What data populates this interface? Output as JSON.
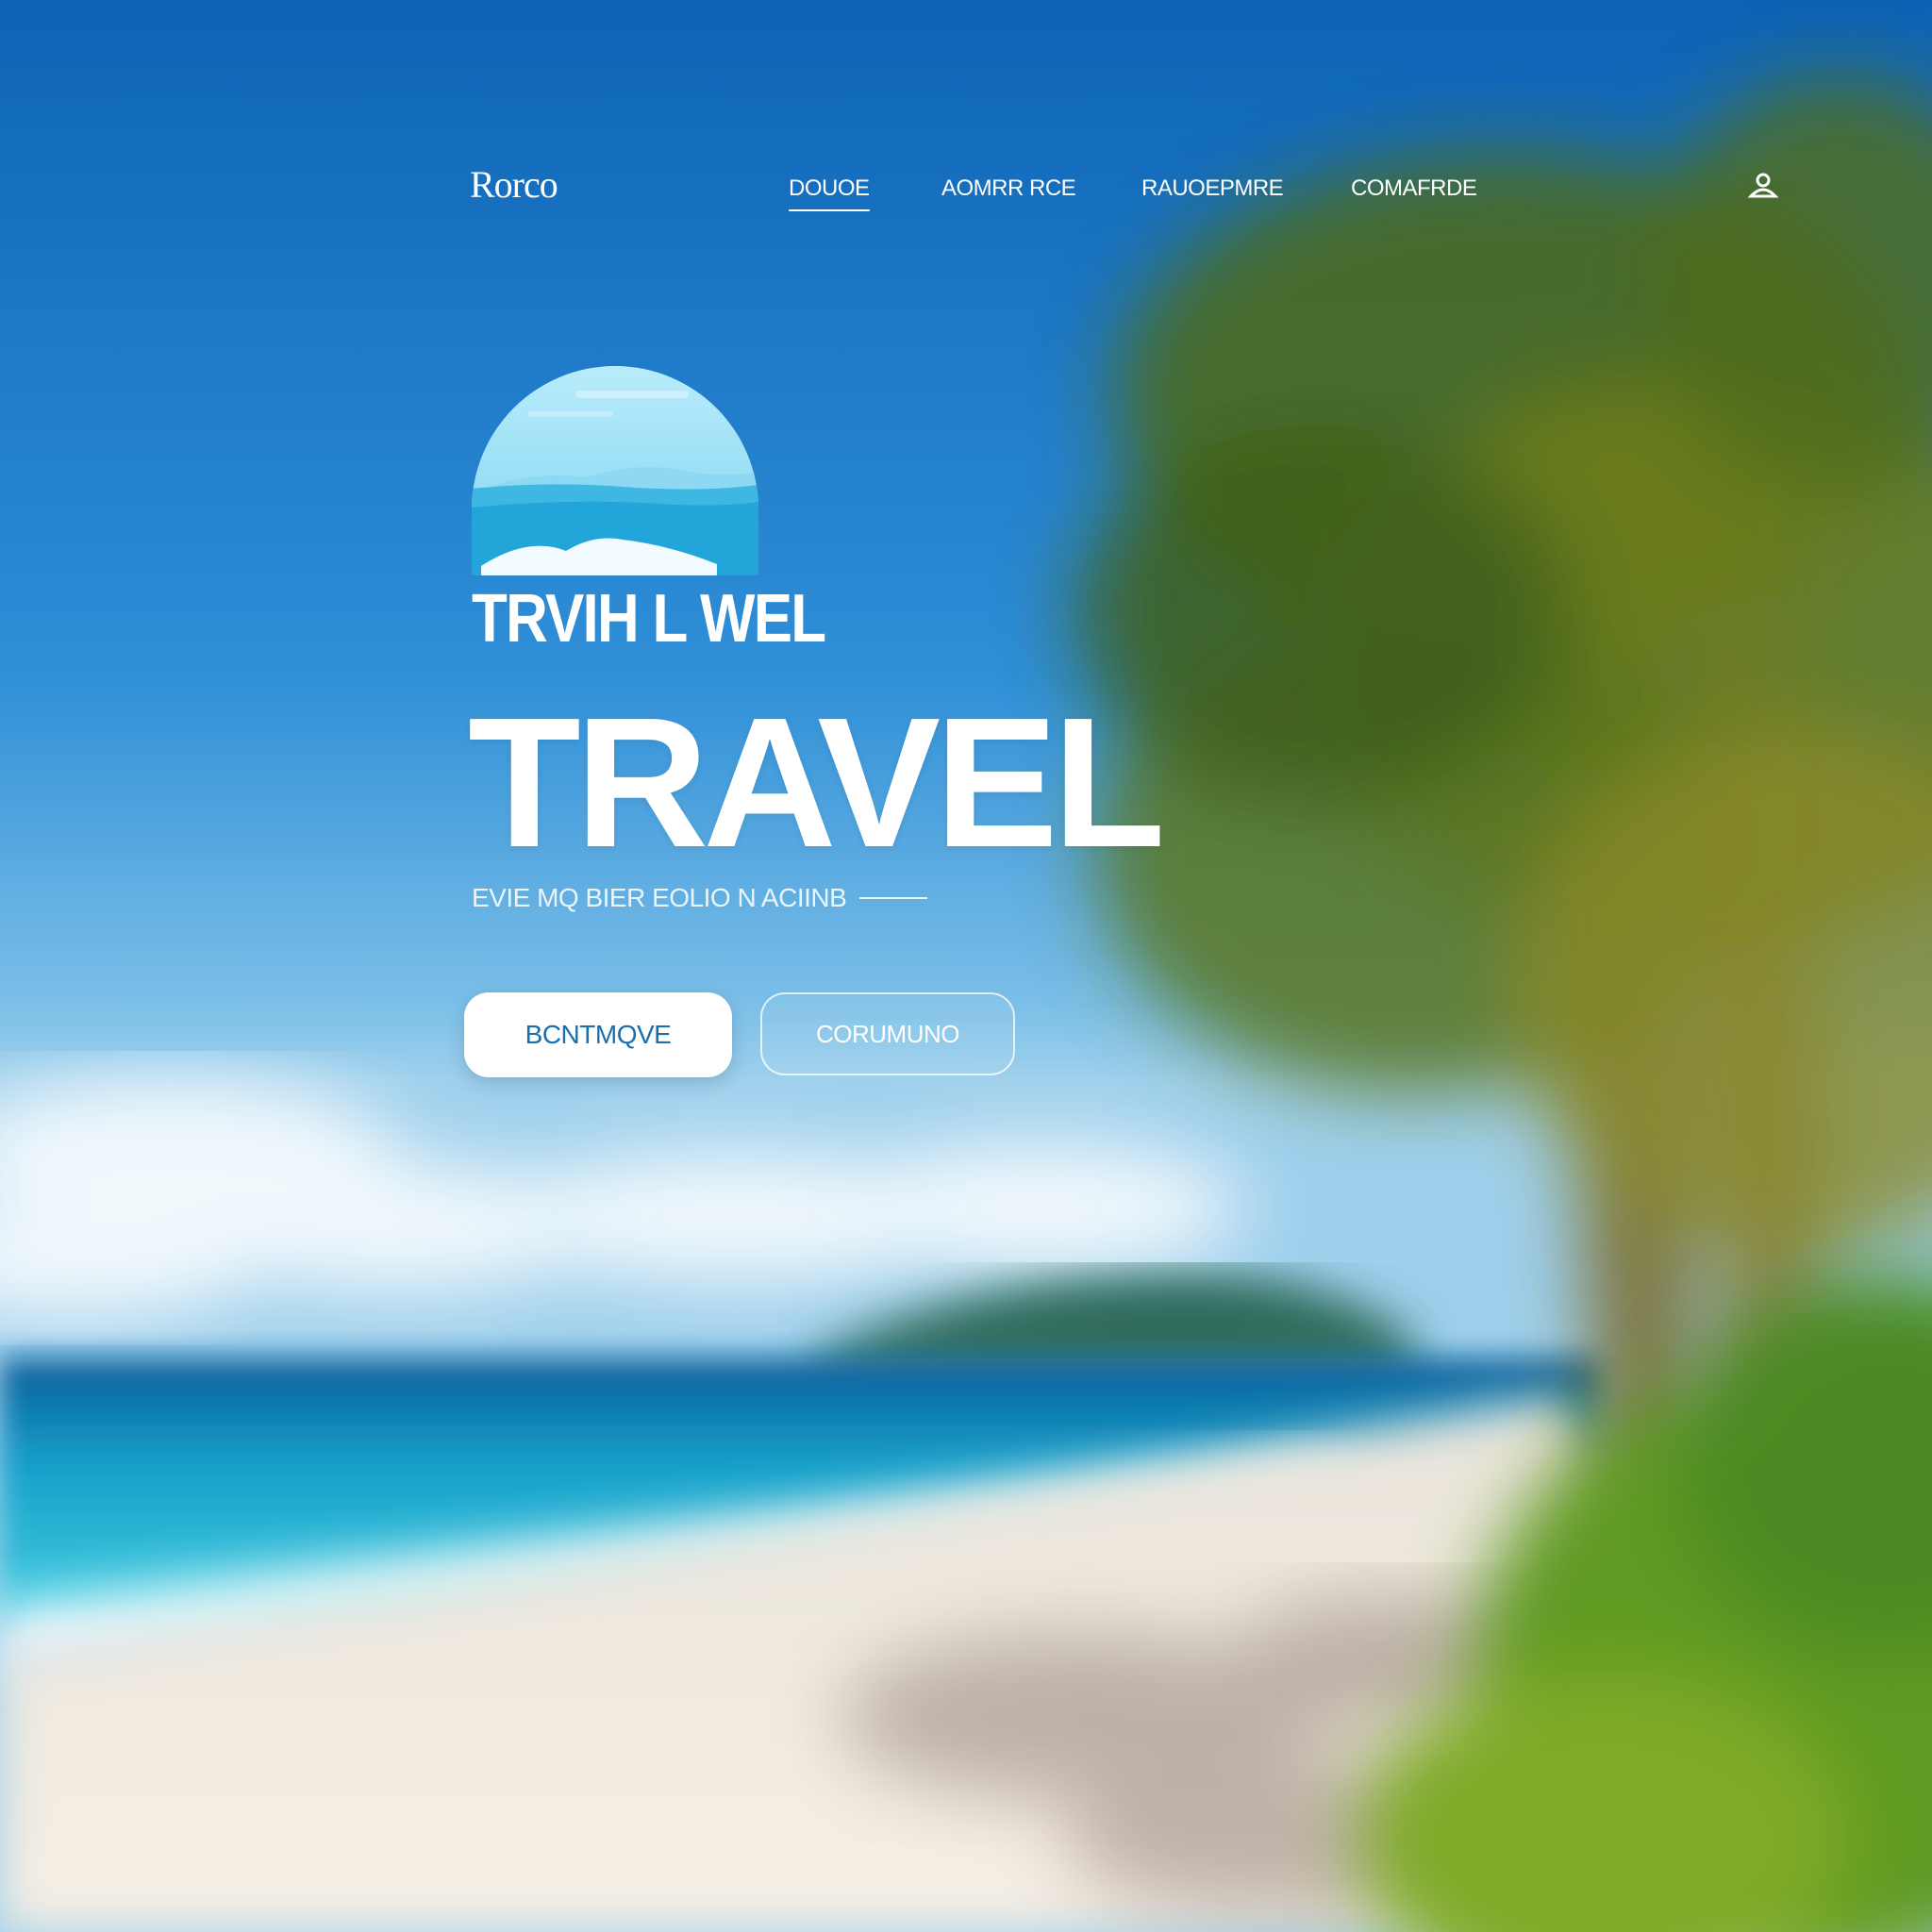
{
  "nav": {
    "brand": "Rorco",
    "items": [
      {
        "label": "DOUOE",
        "active": true
      },
      {
        "label": "AOMRR RCE",
        "active": false
      },
      {
        "label": "RAUOEPMRE",
        "active": false
      },
      {
        "label": "COMAFRDE",
        "active": false
      }
    ],
    "profile_icon": "user-icon"
  },
  "hero": {
    "logo_icon": "sea-mountain-logo",
    "logo_wordmark": "TRVIH L WEL",
    "title": "TRAVEL",
    "tagline": "EVIE MQ BIER EOLIO N ACIINB",
    "primary_button": "BCNTMQVE",
    "secondary_button": "CORUMUNO"
  },
  "colors": {
    "sky_top": "#0e68b9",
    "sea": "#22b5d6",
    "sand": "#f3ece2",
    "palm": "#5a7a1f",
    "button_text": "#1a6fae"
  }
}
